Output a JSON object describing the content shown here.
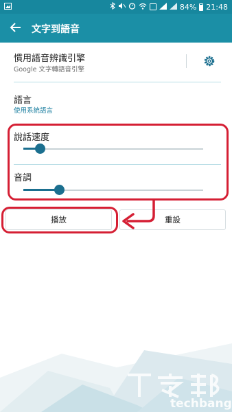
{
  "status_bar": {
    "battery": "84%",
    "time": "21:48"
  },
  "app_bar": {
    "title": "文字到語音"
  },
  "engine": {
    "title": "慣用語音辨識引擎",
    "subtitle": "Google 文字轉語音引擎"
  },
  "language": {
    "title": "語言",
    "subtitle": "使用系統語言"
  },
  "speech_rate": {
    "label": "說話速度",
    "level": 0.1
  },
  "pitch": {
    "label": "音調",
    "level": 0.2
  },
  "buttons": {
    "play": "播放",
    "reset": "重設"
  },
  "watermark": {
    "logo_text": "T客邦",
    "domain": "techbang.com"
  },
  "colors": {
    "app_bar": "#1b8fa6",
    "status_bar": "#17879e",
    "accent": "#1b6f8f",
    "link": "#1c7fa0",
    "annotation": "#d51f34"
  }
}
